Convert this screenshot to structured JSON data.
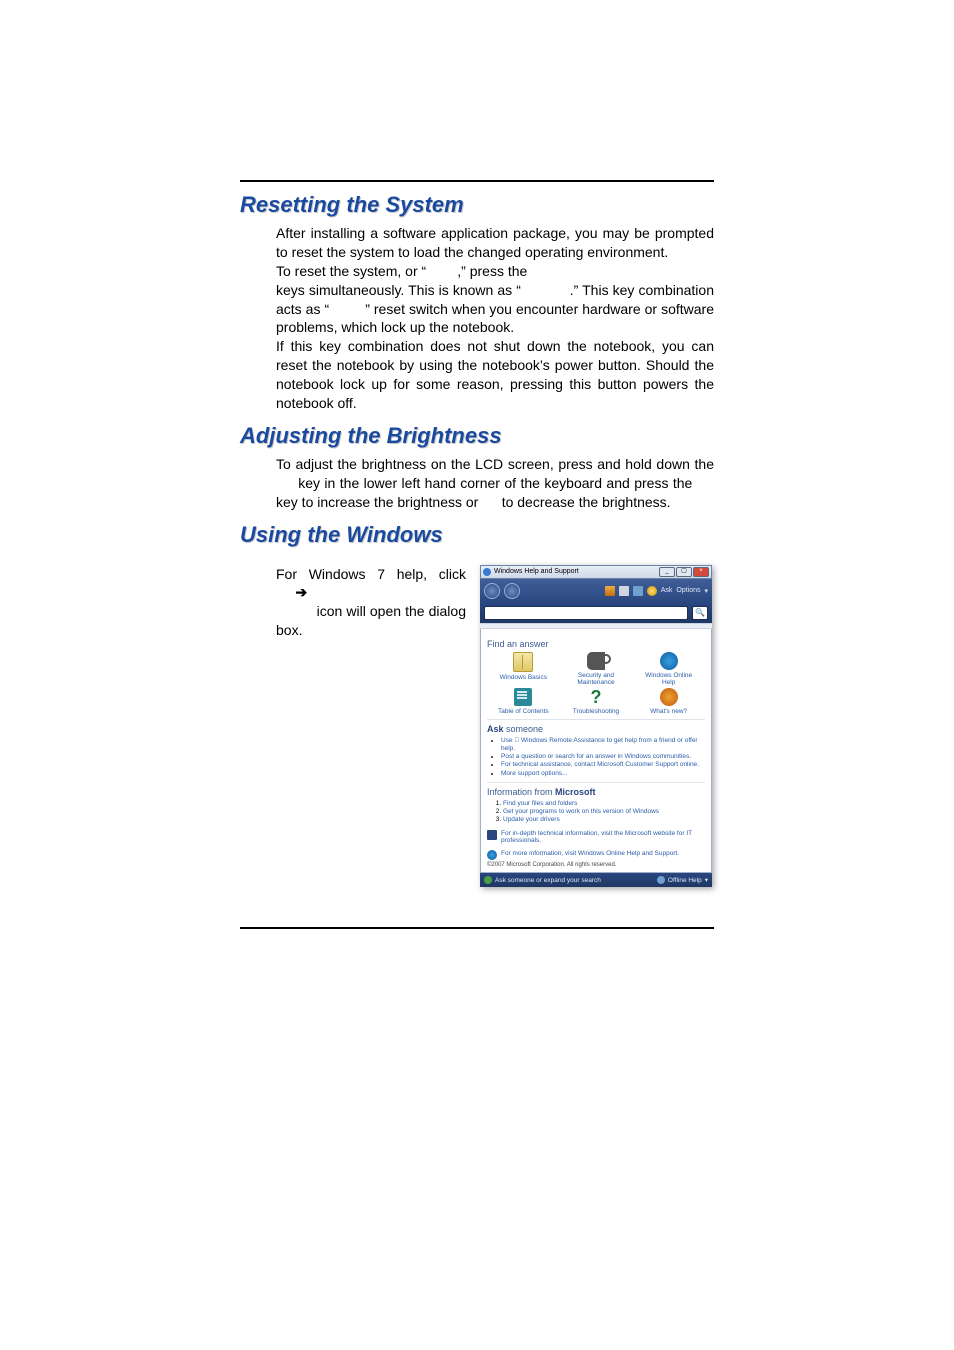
{
  "sections": {
    "resetting": {
      "title": "Resetting the System",
      "p1": "After installing a software application package, you may be prompted to reset the system to load the changed operating environment.",
      "p2a": "To reset the system, or “",
      "p2b": ",” press the",
      "p3a": "keys simultaneously. This is known as “",
      "p3b": ".” This key combination acts as “",
      "p3c": "” reset switch when you encounter hardware or software problems, which lock up the notebook.",
      "p4": "If this key combination does not shut down the notebook, you can reset the notebook by using the notebook’s power button. Should the notebook lock up for some reason, pressing this button powers the notebook off."
    },
    "brightness": {
      "title": "Adjusting the Brightness",
      "p1a": "To adjust the brightness on the LCD screen, press and hold down the",
      "p1b": "key in the lower left hand corner of the keyboard and press the",
      "p1c": "key to increase the brightness or",
      "p1d": "to decrease the brightness."
    },
    "windows": {
      "title": "Using the Windows",
      "p1a": "For Windows 7 help, click",
      "p1b": "icon will open the dialog box."
    }
  },
  "screenshot": {
    "window_title": "Windows Help and Support",
    "toolbar": {
      "ask": "Ask",
      "options": "Options"
    },
    "find_answer": "Find an answer",
    "tiles_row1": [
      {
        "label": "Windows Basics"
      },
      {
        "label": "Security and Maintenance"
      },
      {
        "label": "Windows Online Help"
      }
    ],
    "tiles_row2": [
      {
        "label": "Table of Contents"
      },
      {
        "label": "Troubleshooting"
      },
      {
        "label": "What's new?"
      }
    ],
    "ask_someone_head": "Ask someone",
    "ask_someone": [
      "Use  Windows Remote Assistance to get help from a friend or offer help.",
      "Post a question or search for an answer in Windows communities.",
      "For technical assistance, contact Microsoft Customer Support online.",
      "More support options..."
    ],
    "info_ms_head_a": "Information from ",
    "info_ms_head_b": "Microsoft",
    "info_ms": [
      "Find your files and folders",
      "Get your programs to work on this version of Windows",
      "Update your drivers"
    ],
    "footer1": "For in-depth technical information, visit the Microsoft website for IT professionals.",
    "footer2": "For more information, visit Windows Online Help and Support.",
    "copyright": "©2007 Microsoft Corporation. All rights reserved.",
    "status_left": "Ask someone or expand your search",
    "status_right": "Offline Help"
  }
}
